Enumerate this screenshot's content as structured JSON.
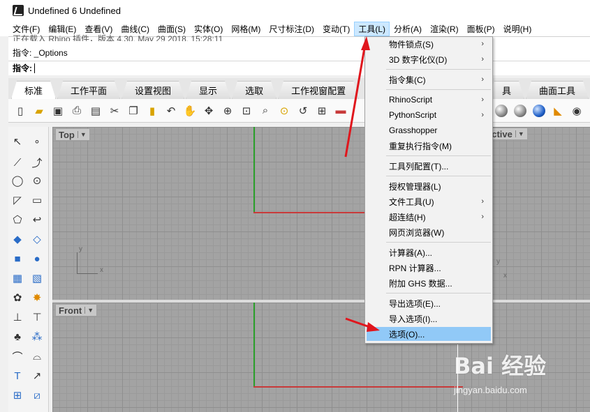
{
  "window": {
    "title": "Undefined 6 Undefined"
  },
  "menubar": {
    "items": [
      {
        "label": "文件(F)"
      },
      {
        "label": "编辑(E)"
      },
      {
        "label": "查看(V)"
      },
      {
        "label": "曲线(C)"
      },
      {
        "label": "曲面(S)"
      },
      {
        "label": "实体(O)"
      },
      {
        "label": "网格(M)"
      },
      {
        "label": "尺寸标注(D)"
      },
      {
        "label": "变动(T)"
      },
      {
        "label": "工具(L)"
      },
      {
        "label": "分析(A)"
      },
      {
        "label": "渲染(R)"
      },
      {
        "label": "面板(P)"
      },
      {
        "label": "说明(H)"
      }
    ],
    "active_index": 9
  },
  "command": {
    "prev_line": "正在载入 Rhino 插件，版本 4.30, May 29 2018, 15:28:11",
    "history": "指令: _Options",
    "prompt": "指令:"
  },
  "tabs": {
    "items": [
      {
        "label": "标准"
      },
      {
        "label": "工作平面"
      },
      {
        "label": "设置视图"
      },
      {
        "label": "显示"
      },
      {
        "label": "选取"
      },
      {
        "label": "工作视窗配置"
      }
    ],
    "right_items": [
      {
        "label": "具"
      },
      {
        "label": "曲面工具"
      }
    ]
  },
  "viewports": {
    "top": {
      "label": "Top"
    },
    "front": {
      "label": "Front"
    },
    "perspective": {
      "label": "ective"
    },
    "axis_x": "x",
    "axis_y": "y"
  },
  "dropdown": {
    "items": [
      {
        "label": "物件锁点(S)",
        "submenu": true
      },
      {
        "label": "3D 数字化仪(D)",
        "submenu": true
      },
      {
        "label": "指令集(C)",
        "submenu": true
      },
      {
        "label": "RhinoScript",
        "submenu": true
      },
      {
        "label": "PythonScript",
        "submenu": true
      },
      {
        "label": "Grasshopper",
        "submenu": false
      },
      {
        "label": "重复执行指令(M)",
        "submenu": false
      },
      {
        "label": "工具列配置(T)...",
        "submenu": false
      },
      {
        "label": "授权管理器(L)",
        "submenu": false
      },
      {
        "label": "文件工具(U)",
        "submenu": true
      },
      {
        "label": "超连结(H)",
        "submenu": true
      },
      {
        "label": "网页浏览器(W)",
        "submenu": false
      },
      {
        "label": "计算器(A)...",
        "submenu": false
      },
      {
        "label": "RPN 计算器...",
        "submenu": false
      },
      {
        "label": "附加 GHS 数据...",
        "submenu": false
      },
      {
        "label": "导出选项(E)...",
        "submenu": false
      },
      {
        "label": "导入选项(I)...",
        "submenu": false
      },
      {
        "label": "选项(O)...",
        "submenu": false
      }
    ],
    "arrow_glyph": "›"
  },
  "watermark": {
    "brand": "Bai  经验",
    "url": "jingyan.baidu.com"
  },
  "colors": {
    "highlight": "#91c9f7",
    "annotation_arrow": "#e0161d"
  }
}
